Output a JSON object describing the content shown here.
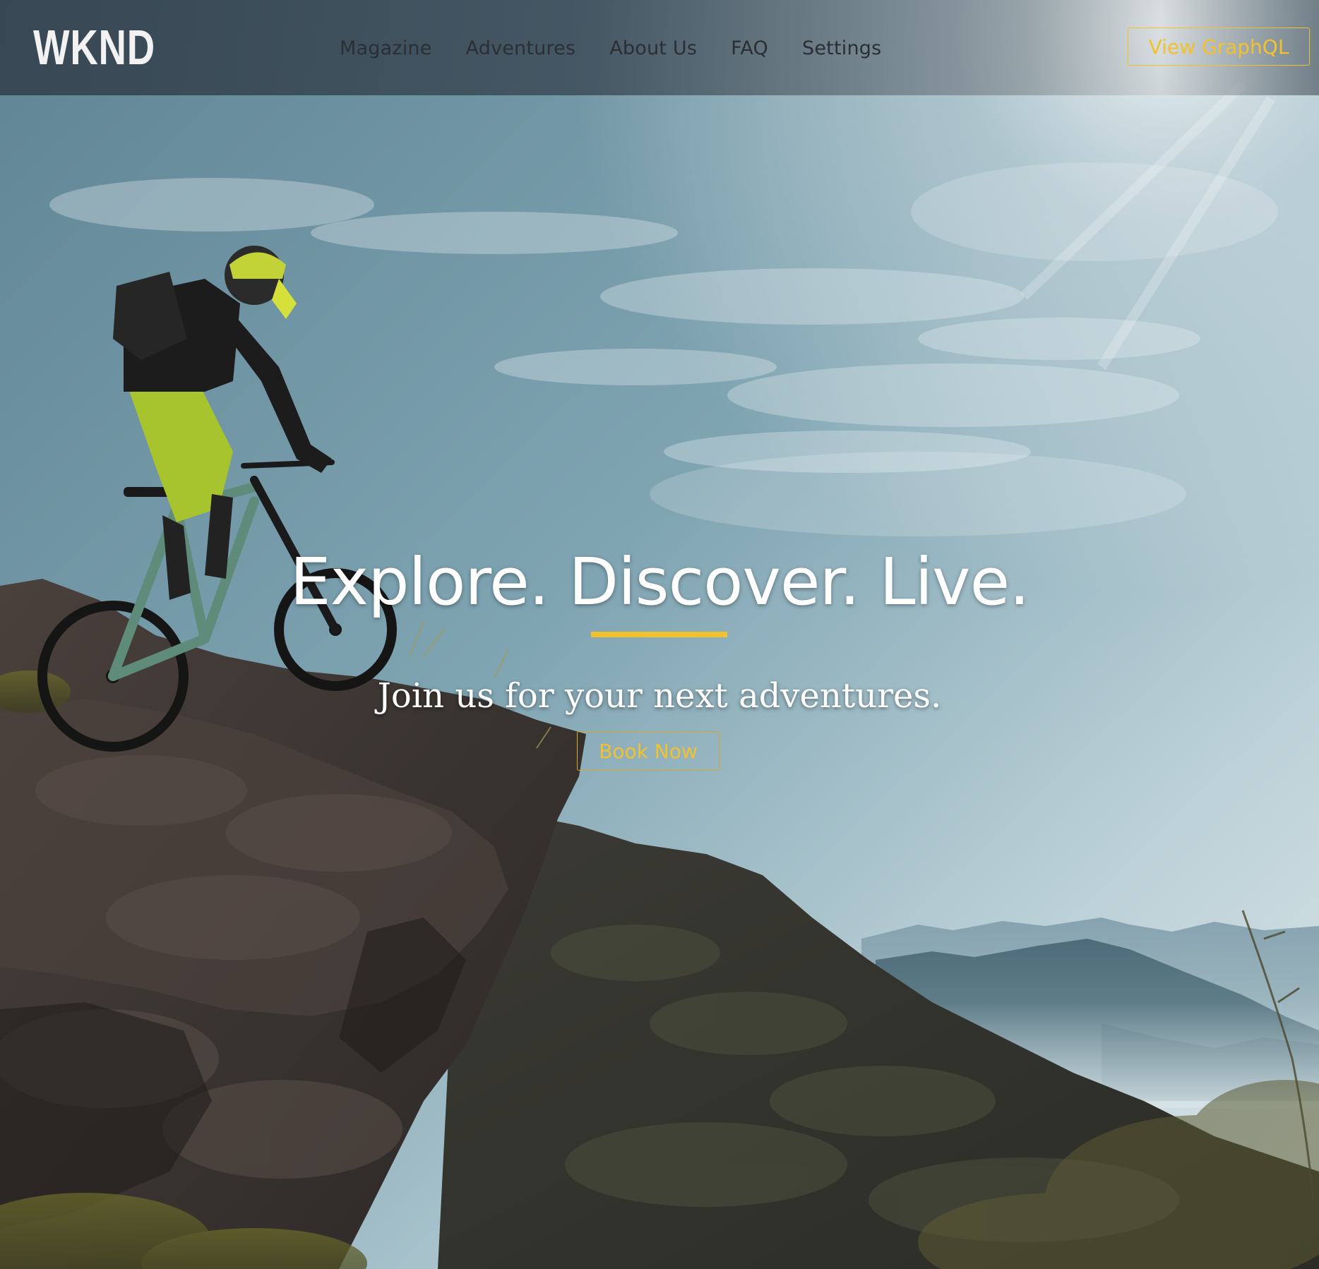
{
  "header": {
    "logo_text": "WKND",
    "nav": [
      {
        "label": "Magazine"
      },
      {
        "label": "Adventures"
      },
      {
        "label": "About Us"
      },
      {
        "label": "FAQ"
      },
      {
        "label": "Settings"
      }
    ],
    "graphql_button_label": "View GraphQL"
  },
  "hero": {
    "title": "Explore. Discover. Live.",
    "subtitle": "Join us for your next adventures.",
    "book_button_label": "Book Now"
  },
  "colors": {
    "accent": "#f2c12e",
    "header_bg": "#34424e",
    "title_text": "#ffffff"
  },
  "icons": [
    "wknd-logo"
  ]
}
